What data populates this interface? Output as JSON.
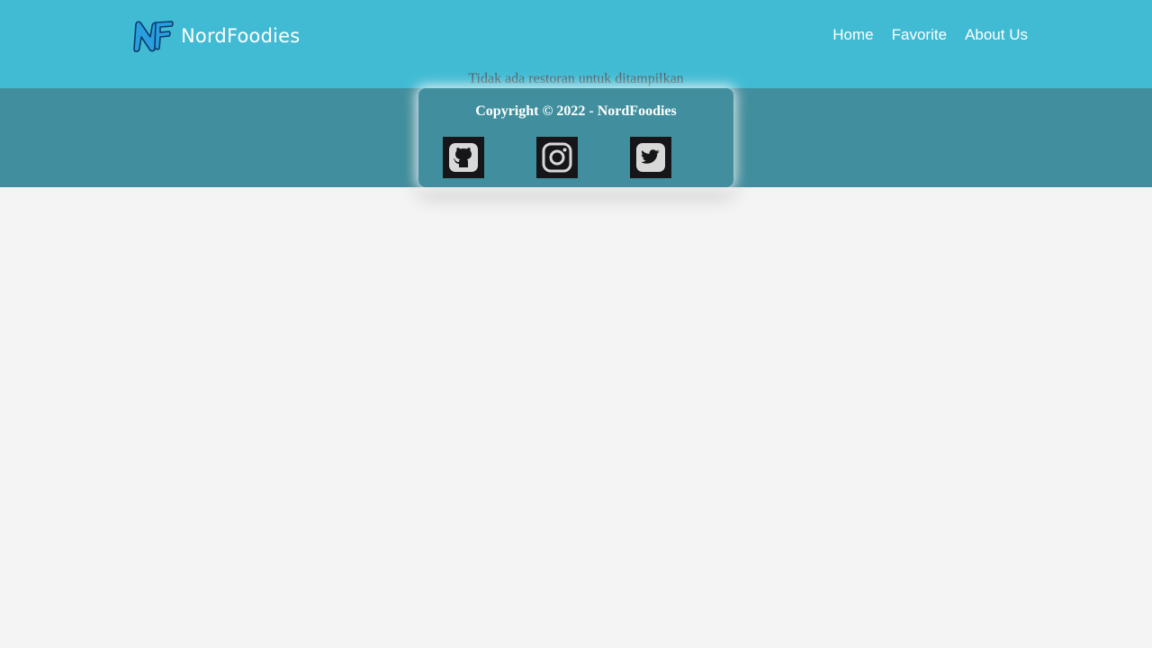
{
  "header": {
    "brand": {
      "logo_icon": "nordfoodies-nf-logo-icon",
      "name": "NordFoodies"
    },
    "nav": [
      {
        "label": "Home"
      },
      {
        "label": "Favorite"
      },
      {
        "label": "About Us"
      }
    ],
    "background_color": "#41bbd4"
  },
  "main": {
    "empty_message": "Tidak ada restoran untuk ditampilkan"
  },
  "footer": {
    "copyright": "Copyright © 2022 - NordFoodies",
    "social_links": [
      {
        "icon": "github-icon"
      },
      {
        "icon": "instagram-icon"
      },
      {
        "icon": "twitter-icon"
      }
    ],
    "background_color": "#418f9e"
  },
  "page": {
    "background_color": "#f4f4f4"
  }
}
